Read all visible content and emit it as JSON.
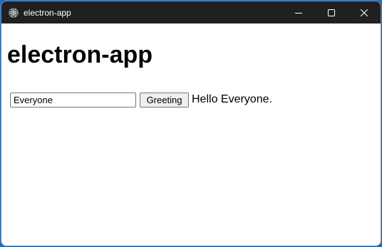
{
  "window": {
    "title": "electron-app",
    "controls": {
      "minimize_icon": "minimize-icon",
      "maximize_icon": "maximize-icon",
      "close_icon": "close-icon"
    },
    "titlebar_color": "#202020"
  },
  "main": {
    "heading": "electron-app",
    "name_input": {
      "value": "Everyone"
    },
    "greeting_button_label": "Greeting",
    "greeting_output": "Hello Everyone."
  }
}
